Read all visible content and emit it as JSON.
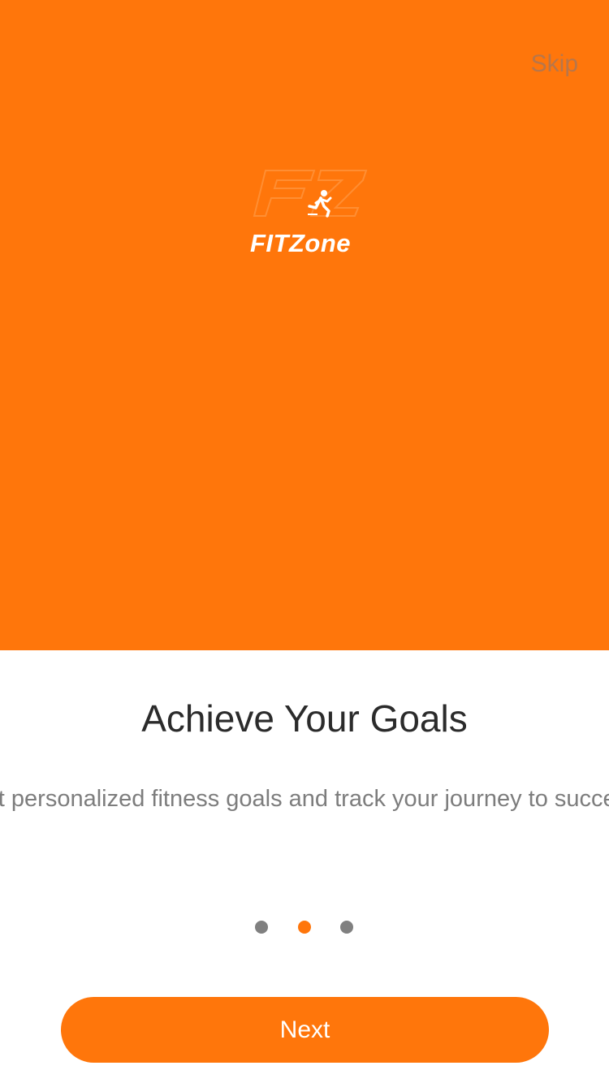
{
  "header": {
    "skip_label": "Skip"
  },
  "hero": {
    "background_color": "#FF760B",
    "logo": {
      "text": "FITZone",
      "mark_text": "FZ",
      "icon": "running-person-icon"
    }
  },
  "onboarding": {
    "title": "Achieve Your Goals",
    "description": "Set personalized fitness goals and track your journey to success",
    "page_indicator": {
      "total": 3,
      "current": 2
    }
  },
  "footer": {
    "next_label": "Next"
  },
  "colors": {
    "accent": "#FF760B",
    "title_text": "#2b2b2b",
    "body_text": "#7d7d7d",
    "inactive_dot": "#808080"
  }
}
